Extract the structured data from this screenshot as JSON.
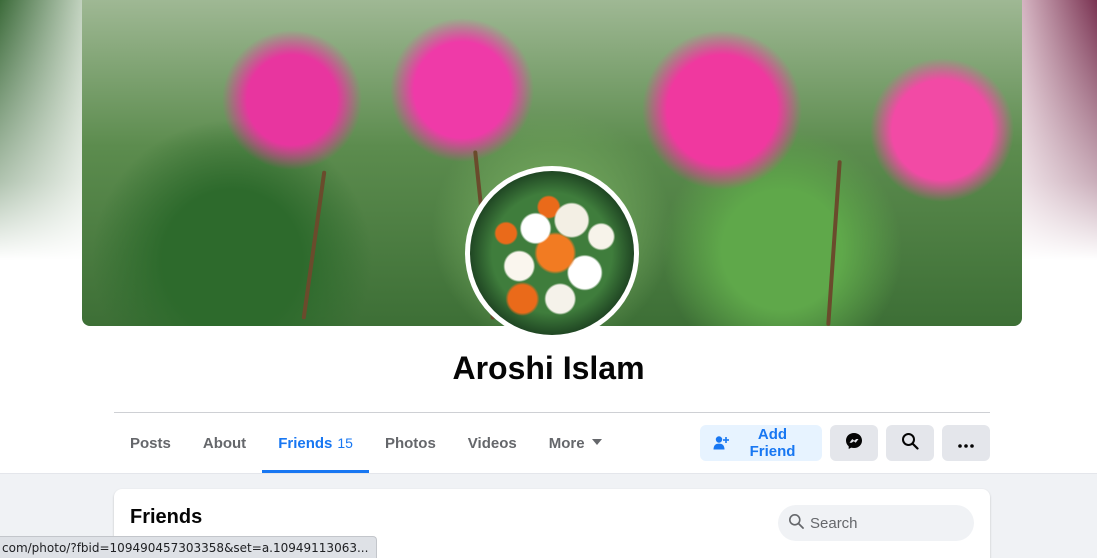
{
  "profile": {
    "name": "Aroshi Islam"
  },
  "tabs": [
    {
      "label": "Posts"
    },
    {
      "label": "About"
    },
    {
      "label": "Friends",
      "count": "15",
      "active": true
    },
    {
      "label": "Photos"
    },
    {
      "label": "Videos"
    },
    {
      "label": "More",
      "icon": "caret-down-icon"
    }
  ],
  "actions": {
    "add_friend_label": "Add Friend",
    "add_friend_icon": "add-person-icon",
    "messenger_icon": "messenger-icon",
    "search_icon": "search-icon",
    "more_icon": "ellipsis-icon"
  },
  "friends_section": {
    "title": "Friends",
    "search_placeholder": "Search"
  },
  "status_bar": {
    "url": "com/photo/?fbid=109490457303358&set=a.10949113063..."
  },
  "colors": {
    "accent": "#1877f2",
    "accent_bg": "#e7f3ff",
    "button_gray": "#e4e6eb",
    "page_bg": "#f0f2f5"
  }
}
